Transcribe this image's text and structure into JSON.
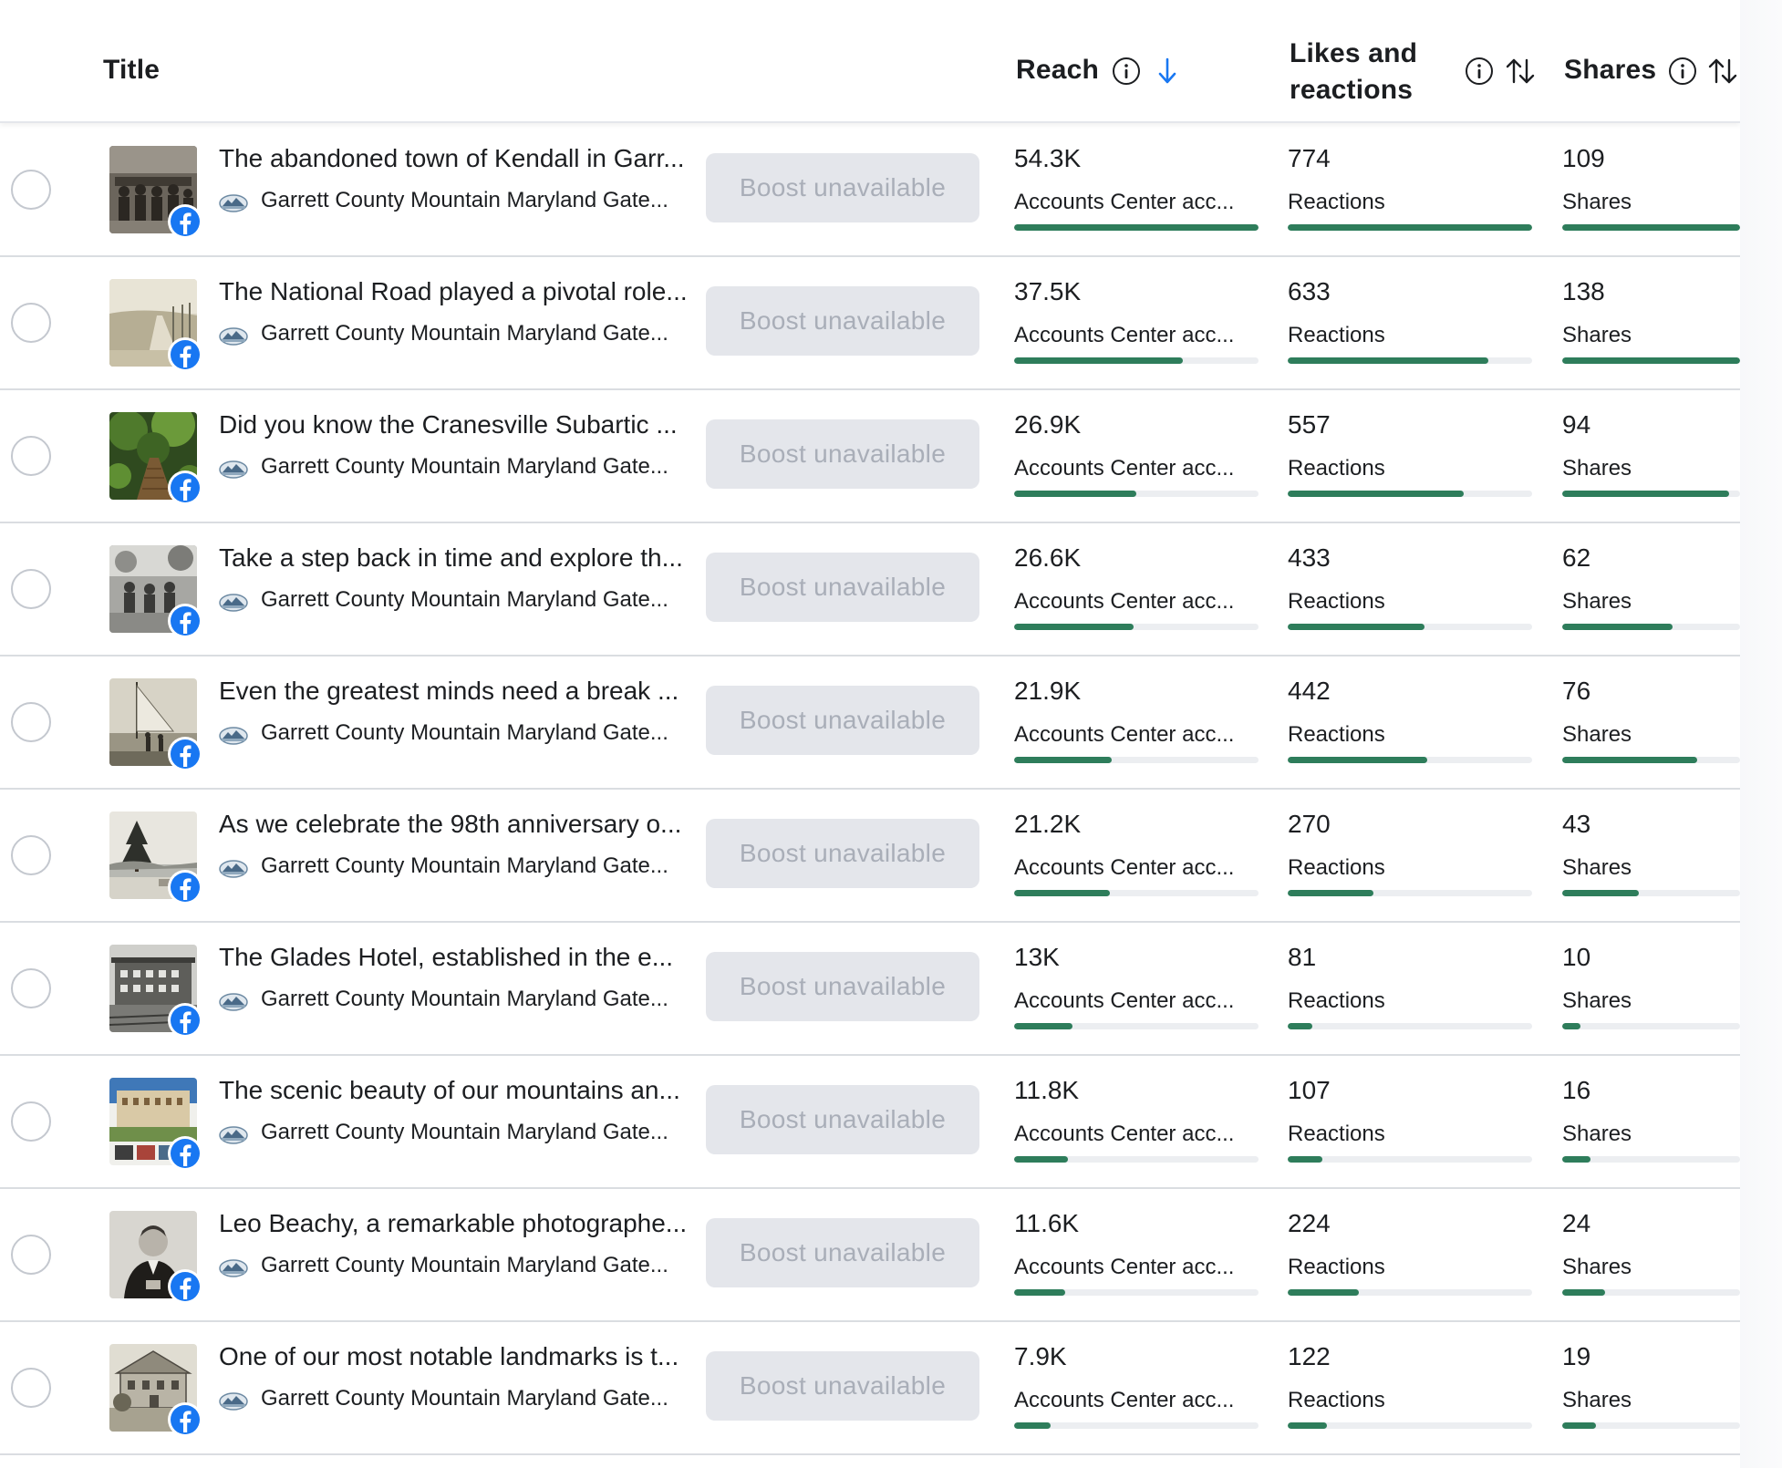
{
  "header": {
    "title": "Title",
    "reach": "Reach",
    "likes_line1": "Likes and",
    "likes_line2": "reactions",
    "shares": "Shares"
  },
  "boost_label": "Boost unavailable",
  "bar_color": "#2e7d5b",
  "rows": [
    {
      "title": "The abandoned town of Kendall in Garr...",
      "page": "Garrett County Mountain Maryland Gate...",
      "reach": "54.3K",
      "reach_label": "Accounts Center acc...",
      "likes": "774",
      "likes_label": "Reactions",
      "shares": "109",
      "shares_label": "Shares",
      "thumb": "sepia-group-photo",
      "reach_fill": 1.0,
      "likes_fill": 1.0,
      "shares_fill": 1.0
    },
    {
      "title": "The National Road played a pivotal role...",
      "page": "Garrett County Mountain Maryland Gate...",
      "reach": "37.5K",
      "reach_label": "Accounts Center acc...",
      "likes": "633",
      "likes_label": "Reactions",
      "shares": "138",
      "shares_label": "Shares",
      "thumb": "vintage-road-postcard",
      "reach_fill": 0.69,
      "likes_fill": 0.82,
      "shares_fill": 1.0
    },
    {
      "title": "Did you know the Cranesville Subartic ...",
      "page": "Garrett County Mountain Maryland Gate...",
      "reach": "26.9K",
      "reach_label": "Accounts Center acc...",
      "likes": "557",
      "likes_label": "Reactions",
      "shares": "94",
      "shares_label": "Shares",
      "thumb": "forest-boardwalk",
      "reach_fill": 0.5,
      "likes_fill": 0.72,
      "shares_fill": 0.94
    },
    {
      "title": "Take a step back in time and explore th...",
      "page": "Garrett County Mountain Maryland Gate...",
      "reach": "26.6K",
      "reach_label": "Accounts Center acc...",
      "likes": "433",
      "likes_label": "Reactions",
      "shares": "62",
      "shares_label": "Shares",
      "thumb": "bw-group-photo",
      "reach_fill": 0.49,
      "likes_fill": 0.56,
      "shares_fill": 0.62
    },
    {
      "title": "Even the greatest minds need a break ...",
      "page": "Garrett County Mountain Maryland Gate...",
      "reach": "21.9K",
      "reach_label": "Accounts Center acc...",
      "likes": "442",
      "likes_label": "Reactions",
      "shares": "76",
      "shares_label": "Shares",
      "thumb": "sailboat-photo",
      "reach_fill": 0.4,
      "likes_fill": 0.57,
      "shares_fill": 0.76
    },
    {
      "title": "As we celebrate the 98th anniversary o...",
      "page": "Garrett County Mountain Maryland Gate...",
      "reach": "21.2K",
      "reach_label": "Accounts Center acc...",
      "likes": "270",
      "likes_label": "Reactions",
      "shares": "43",
      "shares_label": "Shares",
      "thumb": "lakeside-pine-photo",
      "reach_fill": 0.39,
      "likes_fill": 0.35,
      "shares_fill": 0.43
    },
    {
      "title": "The Glades Hotel, established in the e...",
      "page": "Garrett County Mountain Maryland Gate...",
      "reach": "13K",
      "reach_label": "Accounts Center acc...",
      "likes": "81",
      "likes_label": "Reactions",
      "shares": "10",
      "shares_label": "Shares",
      "thumb": "hotel-street-photo",
      "reach_fill": 0.24,
      "likes_fill": 0.1,
      "shares_fill": 0.1
    },
    {
      "title": "The scenic beauty of our mountains an...",
      "page": "Garrett County Mountain Maryland Gate...",
      "reach": "11.8K",
      "reach_label": "Accounts Center acc...",
      "likes": "107",
      "likes_label": "Reactions",
      "shares": "16",
      "shares_label": "Shares",
      "thumb": "resort-collage",
      "reach_fill": 0.22,
      "likes_fill": 0.14,
      "shares_fill": 0.16
    },
    {
      "title": "Leo Beachy, a remarkable photographe...",
      "page": "Garrett County Mountain Maryland Gate...",
      "reach": "11.6K",
      "reach_label": "Accounts Center acc...",
      "likes": "224",
      "likes_label": "Reactions",
      "shares": "24",
      "shares_label": "Shares",
      "thumb": "portrait-photo",
      "reach_fill": 0.21,
      "likes_fill": 0.29,
      "shares_fill": 0.24
    },
    {
      "title": "One of our most notable landmarks is t...",
      "page": "Garrett County Mountain Maryland Gate...",
      "reach": "7.9K",
      "reach_label": "Accounts Center acc...",
      "likes": "122",
      "likes_label": "Reactions",
      "shares": "19",
      "shares_label": "Shares",
      "thumb": "landmark-building-sketch",
      "reach_fill": 0.15,
      "likes_fill": 0.16,
      "shares_fill": 0.19
    }
  ]
}
